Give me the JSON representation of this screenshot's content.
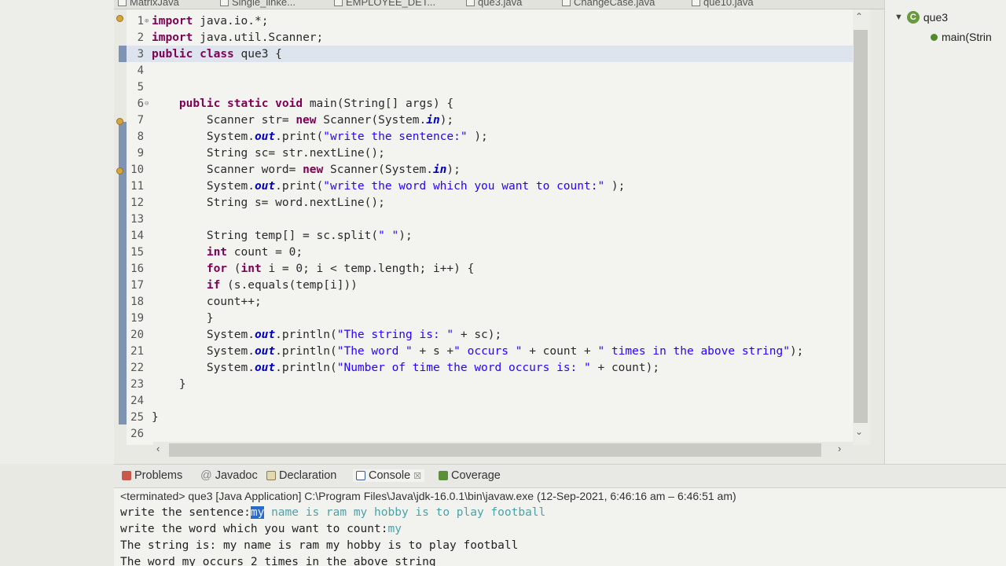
{
  "editor_tabs": [
    "MatrixJava",
    "Single_linke...",
    "EMPLOYEE_DET...",
    "que3.java",
    "ChangeCase.java",
    "que10.java"
  ],
  "code_lines": [
    {
      "n": "1",
      "text": "import java.io.*;",
      "fold": "⊕"
    },
    {
      "n": "2",
      "text": "import java.util.Scanner;"
    },
    {
      "n": "3",
      "text": "public class que3 {",
      "current": true
    },
    {
      "n": "4",
      "text": ""
    },
    {
      "n": "5",
      "text": ""
    },
    {
      "n": "6",
      "text": "    public static void main(String[] args) {",
      "fold": "⊖"
    },
    {
      "n": "7",
      "text": "        Scanner str= new Scanner(System.in);"
    },
    {
      "n": "8",
      "text": "        System.out.print(\"write the sentence:\" );"
    },
    {
      "n": "9",
      "text": "        String sc= str.nextLine();"
    },
    {
      "n": "10",
      "text": "        Scanner word= new Scanner(System.in);"
    },
    {
      "n": "11",
      "text": "        System.out.print(\"write the word which you want to count:\" );"
    },
    {
      "n": "12",
      "text": "        String s= word.nextLine();"
    },
    {
      "n": "13",
      "text": ""
    },
    {
      "n": "14",
      "text": "        String temp[] = sc.split(\" \");"
    },
    {
      "n": "15",
      "text": "        int count = 0;"
    },
    {
      "n": "16",
      "text": "        for (int i = 0; i < temp.length; i++) {"
    },
    {
      "n": "17",
      "text": "        if (s.equals(temp[i]))"
    },
    {
      "n": "18",
      "text": "        count++;"
    },
    {
      "n": "19",
      "text": "        }"
    },
    {
      "n": "20",
      "text": "        System.out.println(\"The string is: \" + sc);"
    },
    {
      "n": "21",
      "text": "        System.out.println(\"The word \" + s +\" occurs \" + count + \" times in the above string\");"
    },
    {
      "n": "22",
      "text": "        System.out.println(\"Number of time the word occurs is: \" + count);"
    },
    {
      "n": "23",
      "text": "    }"
    },
    {
      "n": "24",
      "text": ""
    },
    {
      "n": "25",
      "text": "}"
    },
    {
      "n": "26",
      "text": ""
    }
  ],
  "outline": {
    "class_name": "que3",
    "method": "main(Strin"
  },
  "console_tabs": [
    "Problems",
    "Javadoc",
    "Declaration",
    "Console",
    "Coverage"
  ],
  "console_close": "☒",
  "console": {
    "terminated": "<terminated> que3 [Java Application] C:\\Program Files\\Java\\jdk-16.0.1\\bin\\javaw.exe  (12-Sep-2021, 6:46:16 am – 6:46:51 am)",
    "l1_prompt": "write the sentence:",
    "l1_sel": "my",
    "l1_input": " name is ram my hobby is to play football",
    "l2_prompt": "write the word which you want to count:",
    "l2_input": "my",
    "l3": "The string is: my name is ram my hobby is to play football",
    "l4": "The word my occurs 2 times in the above string"
  },
  "colors": {
    "keyword": "#7f0055",
    "string": "#2a00ff",
    "selection": "#2a6acb",
    "ruler": "#7f93b5"
  }
}
